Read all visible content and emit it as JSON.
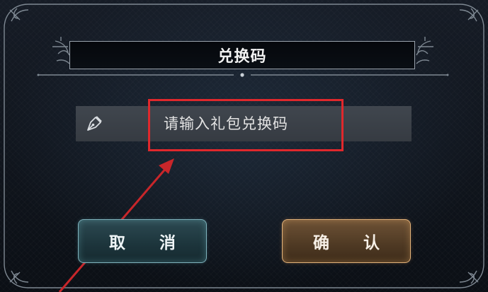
{
  "dialog": {
    "title": "兑换码",
    "input_placeholder": "请输入礼包兑换码",
    "cancel_label": "取 消",
    "confirm_label": "确 认"
  },
  "icons": {
    "input": "pen-nib-icon"
  },
  "colors": {
    "highlight_box": "#e0282c",
    "annotation_arrow": "#c8262a",
    "cancel_accent": "#7fb2bc",
    "confirm_accent": "#e2b27a"
  }
}
